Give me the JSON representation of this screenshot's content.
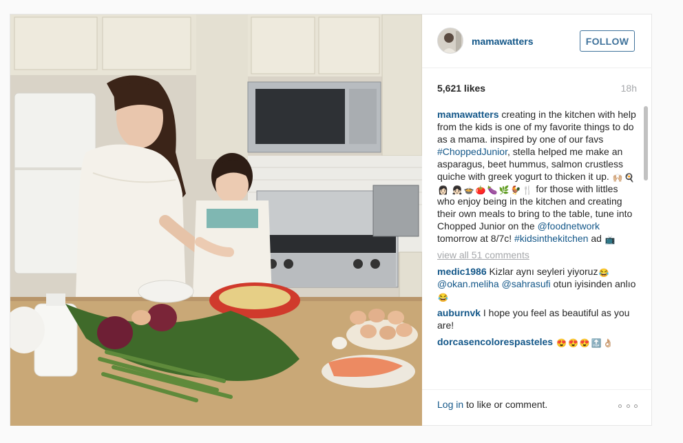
{
  "post": {
    "username": "mamawatters",
    "follow_label": "FOLLOW",
    "likes": "5,621 likes",
    "time": "18h",
    "caption": {
      "username": "mamawatters",
      "text_1": "creating in the kitchen with help from the kids is one of my favorite things to do as a mama. inspired by one of our favs",
      "hashtag_1": "#ChoppedJunior",
      "text_2": ", stella helped me make an asparagus, beet hummus, salmon crustless quiche with greek yogurt to thicken it up.",
      "emojis_1": [
        "🙌🏼",
        "🍳",
        "👩🏻",
        "👧🏻",
        "🍲",
        "🍅",
        "🍆",
        "🌿",
        "🐓",
        "🍴"
      ],
      "text_3": "for those with littles who enjoy being in the kitchen and creating their own meals to bring to the table, tune into Chopped Junior on the",
      "mention_1": "@foodnetwork",
      "text_4": "tomorrow at 8/7c!",
      "hashtag_2": "#kidsinthekitchen",
      "text_5": "ad",
      "emoji_end": "📺"
    },
    "view_all": "view all 51 comments",
    "comments": [
      {
        "username": "medic1986",
        "text_a": "Kizlar aynı seyleri yiyoruz",
        "emoji_a": "😂",
        "mention_a": "@okan.meliha",
        "mention_b": "@sahrasufi",
        "text_b": "otun iyisinden anlıo",
        "emoji_b": "😂"
      },
      {
        "username": "auburnvk",
        "text": "I hope you feel as beautiful as you are!"
      },
      {
        "username": "dorcasencolorespasteles",
        "emojis": [
          "😍",
          "😍",
          "😍",
          "🔝",
          "👌🏼"
        ]
      }
    ],
    "login_link": "Log in",
    "login_text": "to like or comment."
  },
  "icons": {
    "more": "more-options-icon",
    "avatar": "avatar"
  },
  "colors": {
    "link": "#125688",
    "follow": "#3f729b",
    "muted": "#a5a7aa"
  }
}
